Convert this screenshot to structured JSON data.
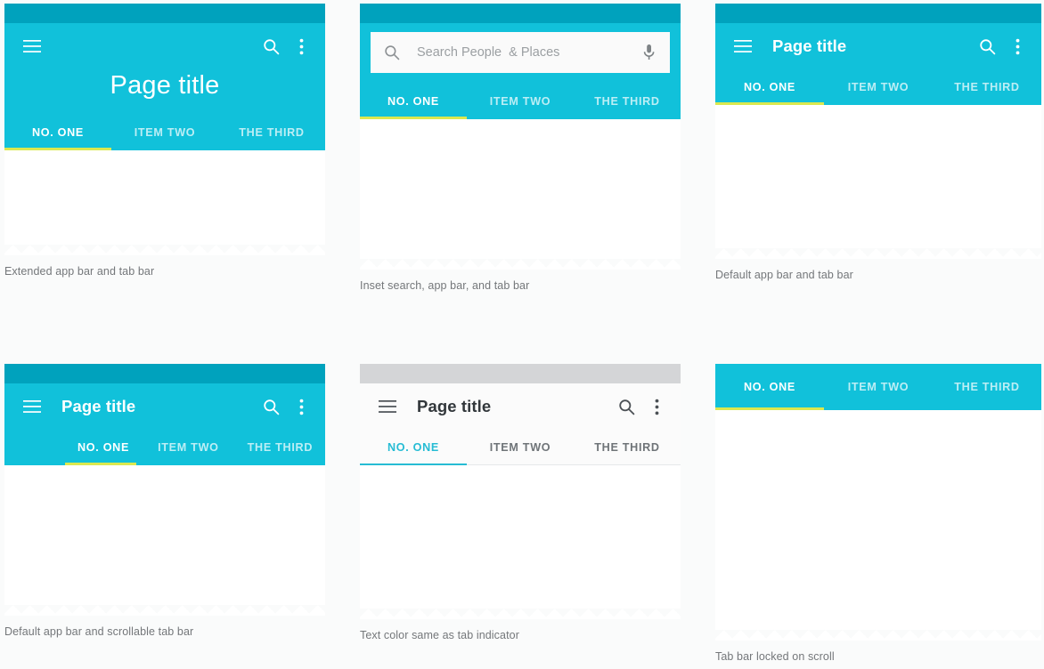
{
  "theme": {
    "primary": "#11c1da",
    "primary_dark": "#00a2bd",
    "indicator_yellow": "#dbe84f",
    "indicator_teal": "#26bcd4",
    "page_background": "#fafbfb",
    "status_grey": "#d4d5d7",
    "caption_text": "#74777a"
  },
  "tabs": {
    "one": "NO. ONE",
    "two": "ITEM TWO",
    "three": "THE THIRD"
  },
  "panels": [
    {
      "id": "extended-app-bar",
      "title": "Page title",
      "caption": "Extended app bar and tab bar",
      "tabs": [
        "NO. ONE",
        "ITEM TWO",
        "THE THIRD"
      ],
      "active_tab": "NO. ONE",
      "icons": [
        "menu-icon",
        "search-icon",
        "overflow-menu-icon"
      ]
    },
    {
      "id": "inset-search",
      "search_placeholder": "Search People  & Places",
      "caption": "Inset search, app bar, and tab bar",
      "tabs": [
        "NO. ONE",
        "ITEM TWO",
        "THE THIRD"
      ],
      "active_tab": "NO. ONE",
      "icons": [
        "search-icon",
        "microphone-icon"
      ]
    },
    {
      "id": "default-app-bar",
      "title": "Page title",
      "caption": "Default app bar and tab bar",
      "tabs": [
        "NO. ONE",
        "ITEM TWO",
        "THE THIRD"
      ],
      "active_tab": "NO. ONE",
      "icons": [
        "menu-icon",
        "search-icon",
        "overflow-menu-icon"
      ]
    },
    {
      "id": "scrollable-tab-bar",
      "title": "Page title",
      "caption": "Default app bar and scrollable tab bar",
      "tabs": [
        "NO. ONE",
        "ITEM TWO",
        "THE THIRD"
      ],
      "active_tab": "NO. ONE",
      "icons": [
        "menu-icon",
        "search-icon",
        "overflow-menu-icon"
      ]
    },
    {
      "id": "light-app-bar",
      "title": "Page title",
      "caption": "Text color same as tab indicator",
      "tabs": [
        "NO. ONE",
        "ITEM TWO",
        "THE THIRD"
      ],
      "active_tab": "NO. ONE",
      "icons": [
        "menu-icon",
        "search-icon",
        "overflow-menu-icon"
      ]
    },
    {
      "id": "tab-bar-locked",
      "caption": "Tab bar locked on scroll",
      "tabs": [
        "NO. ONE",
        "ITEM TWO",
        "THE THIRD"
      ],
      "active_tab": "NO. ONE",
      "icons": []
    }
  ]
}
